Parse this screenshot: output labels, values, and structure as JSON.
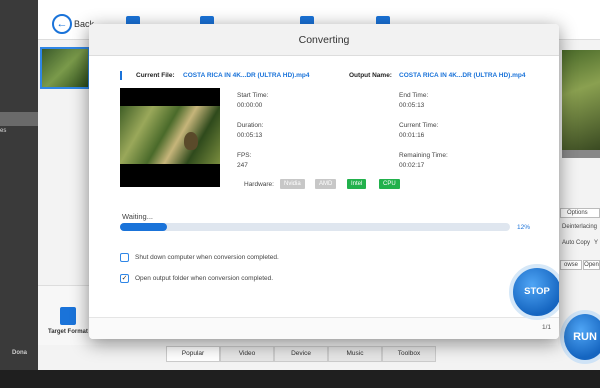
{
  "app": {
    "back_label": "Back",
    "left_text": "es",
    "left_bottom": "Dona",
    "right_options": {
      "options_label": "Options",
      "deinterlacing_label": "Deinterlacing",
      "auto_copy_label": "Auto Copy",
      "auto_copy_value": "Y",
      "browse_label": "owse",
      "open_label": "Open"
    },
    "target_format_label": "Target Format",
    "tabs": [
      {
        "label": "Popular"
      },
      {
        "label": "Video"
      },
      {
        "label": "Device"
      },
      {
        "label": "Music"
      },
      {
        "label": "Toolbox"
      }
    ],
    "run_label": "RUN"
  },
  "dialog": {
    "title": "Converting",
    "current_file_label": "Current File:",
    "current_file_value": "COSTA RICA IN 4K...DR (ULTRA HD).mp4",
    "output_name_label": "Output Name:",
    "output_name_value": "COSTA RICA IN 4K...DR (ULTRA HD).mp4",
    "start_time_label": "Start Time:",
    "start_time_value": "00:00:00",
    "end_time_label": "End Time:",
    "end_time_value": "00:05:13",
    "duration_label": "Duration:",
    "duration_value": "00:05:13",
    "current_time_label": "Current Time:",
    "current_time_value": "00:01:16",
    "fps_label": "FPS:",
    "fps_value": "247",
    "remaining_time_label": "Remaining Time:",
    "remaining_time_value": "00:02:17",
    "hardware_label": "Hardware:",
    "hardware": [
      {
        "label": "Nvidia",
        "active": false,
        "color": "#c7c7c7"
      },
      {
        "label": "AMD",
        "active": false,
        "color": "#c7c7c7"
      },
      {
        "label": "Intel",
        "active": true,
        "color": "#22b14c"
      },
      {
        "label": "CPU",
        "active": true,
        "color": "#22b14c"
      }
    ],
    "status_text": "Waiting...",
    "progress": 0.12,
    "progress_text": "12%",
    "option_shutdown_label": "Shut down computer when conversion completed.",
    "option_shutdown_checked": false,
    "option_open_folder_label": "Open output folder when conversion completed.",
    "option_open_folder_checked": true,
    "stop_label": "STOP",
    "page_count": "1/1"
  },
  "colors": {
    "accent": "#1a73d9",
    "active_badge": "#22b14c",
    "inactive_badge": "#c7c7c7"
  }
}
